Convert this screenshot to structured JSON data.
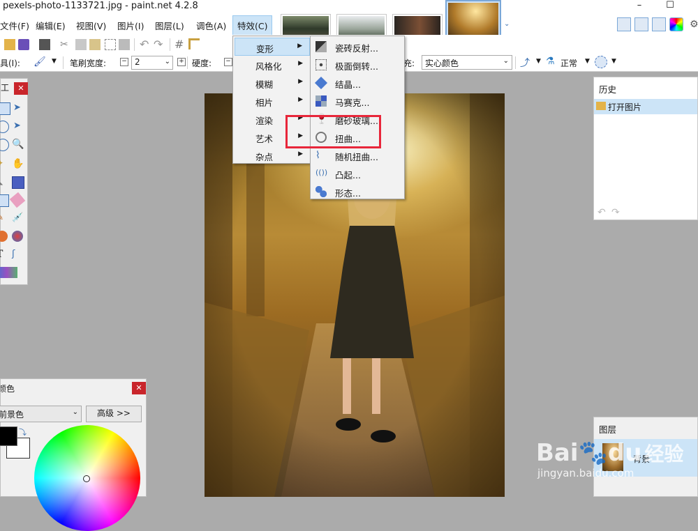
{
  "window": {
    "title": "pexels-photo-1133721.jpg - paint.net 4.2.8",
    "minimize": "–",
    "maximize": "☐"
  },
  "menubar": [
    "文件(F)",
    "编辑(E)",
    "视图(V)",
    "图片(I)",
    "图层(L)",
    "调色(A)",
    "特效(C)"
  ],
  "toolbar2": {
    "tool_label": "具(I):",
    "brush_width_label": "笔刷宽度:",
    "brush_width_value": "2",
    "hardness_label": "硬度:",
    "fill_label": "充:",
    "fill_value": "实心颜色",
    "blend_mode": "正常"
  },
  "effects_menu": [
    {
      "label": "变形",
      "highlighted": true
    },
    {
      "label": "风格化"
    },
    {
      "label": "模糊"
    },
    {
      "label": "相片"
    },
    {
      "label": "渲染"
    },
    {
      "label": "艺术"
    },
    {
      "label": "杂点"
    }
  ],
  "distort_menu": [
    {
      "label": "瓷砖反射...",
      "icon": "tile-reflection-icon"
    },
    {
      "label": "极面倒转...",
      "icon": "polar-inversion-icon"
    },
    {
      "label": "结晶...",
      "icon": "crystal-icon"
    },
    {
      "label": "马赛克...",
      "icon": "mosaic-icon"
    },
    {
      "label": "磨砂玻璃...",
      "icon": "frosted-glass-icon"
    },
    {
      "label": "扭曲...",
      "icon": "twist-icon"
    },
    {
      "label": "随机扭曲...",
      "icon": "dents-icon"
    },
    {
      "label": "凸起...",
      "icon": "bulge-icon"
    },
    {
      "label": "形态...",
      "icon": "morphology-icon"
    }
  ],
  "tools_window": {
    "title": "工"
  },
  "history": {
    "title": "历史",
    "items": [
      "打开图片"
    ]
  },
  "layers": {
    "title": "图层",
    "items": [
      "背景"
    ]
  },
  "colors": {
    "title": "颜色",
    "selector": "前景色",
    "advanced": "高级 >>"
  },
  "watermark": {
    "brand": "Bai",
    "brand2": "du",
    "jingyan": "经验",
    "url": "jingyan.baidu.com"
  }
}
